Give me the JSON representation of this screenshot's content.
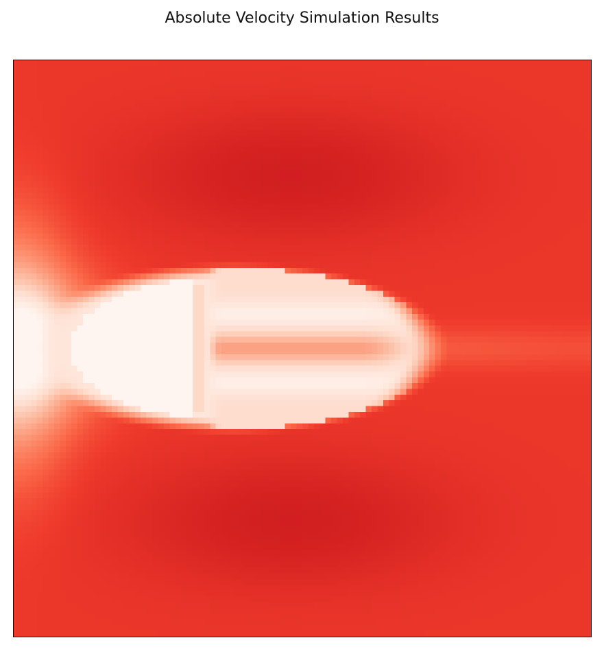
{
  "chart_data": {
    "type": "heatmap",
    "title": "Absolute Velocity Simulation Results",
    "xlabel": "",
    "ylabel": "",
    "axes_ticks": false,
    "colormap": "Reds",
    "colormap_stops": [
      "#fff5f0",
      "#fee0d2",
      "#fcbba1",
      "#fc9272",
      "#fb6a4a",
      "#ef3b2c",
      "#cb181d"
    ],
    "grid_shape": [
      100,
      100
    ],
    "field": {
      "free_stream_level": 0.85,
      "stagnation_level": 0.0,
      "body_level": 0.0,
      "wake_core_level": 0.45,
      "wake_shear_level": 0.05,
      "accelerated_flank_level": 0.97
    }
  }
}
